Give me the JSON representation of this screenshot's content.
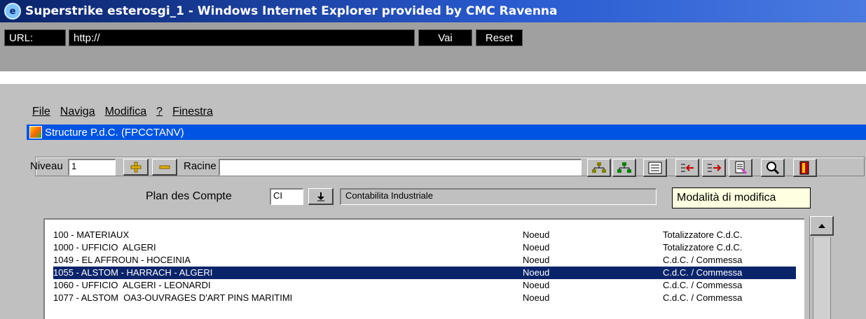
{
  "window": {
    "title": "Superstrike esterosgi_1 - Windows Internet Explorer provided by CMC Ravenna"
  },
  "urlbar": {
    "label": "URL:",
    "value": "http://",
    "go_label": "Vai",
    "reset_label": "Reset"
  },
  "menu": {
    "items": [
      "File",
      "Naviga",
      "Modifica",
      "?",
      "Finestra"
    ]
  },
  "form": {
    "title": "Structure P.d.C. (FPCCTANV)",
    "niveau_label": "Niveau",
    "niveau_value": "1",
    "racine_label": "Racine",
    "racine_value": "",
    "plan_label": "Plan des Compte",
    "plan_code": "CI",
    "plan_desc": "Contabilita Industriale",
    "mode_label": "Modalità di modifica"
  },
  "toolbar_icons": [
    "tree-expand-icon",
    "tree-collapse-icon",
    "list-icon",
    "move-left-icon",
    "move-right-icon",
    "refresh-icon",
    "search-icon",
    "exit-icon"
  ],
  "rows": [
    {
      "name": "100 - MATERIAUX",
      "type": "Noeud",
      "kind": "Totalizzatore C.d.C.",
      "selected": false
    },
    {
      "name": "1000 - UFFICIO  ALGERI",
      "type": "Noeud",
      "kind": "Totalizzatore C.d.C.",
      "selected": false
    },
    {
      "name": "1049 - EL AFFROUN - HOCEINIA",
      "type": "Noeud",
      "kind": "C.d.C. / Commessa",
      "selected": false
    },
    {
      "name": "1055 - ALSTOM - HARRACH - ALGERI",
      "type": "Noeud",
      "kind": "C.d.C. / Commessa",
      "selected": true
    },
    {
      "name": "1060 - UFFICIO  ALGERI - LEONARDI",
      "type": "Noeud",
      "kind": "C.d.C. / Commessa",
      "selected": false
    },
    {
      "name": "1077 - ALSTOM  OA3-OUVRAGES D'ART PINS MARITIMI",
      "type": "Noeud",
      "kind": "C.d.C. / Commessa",
      "selected": false
    }
  ],
  "colors": {
    "selection": "#0a246a",
    "form_title_bar": "#0054e3",
    "tooltip_bg": "#ffffe1"
  }
}
